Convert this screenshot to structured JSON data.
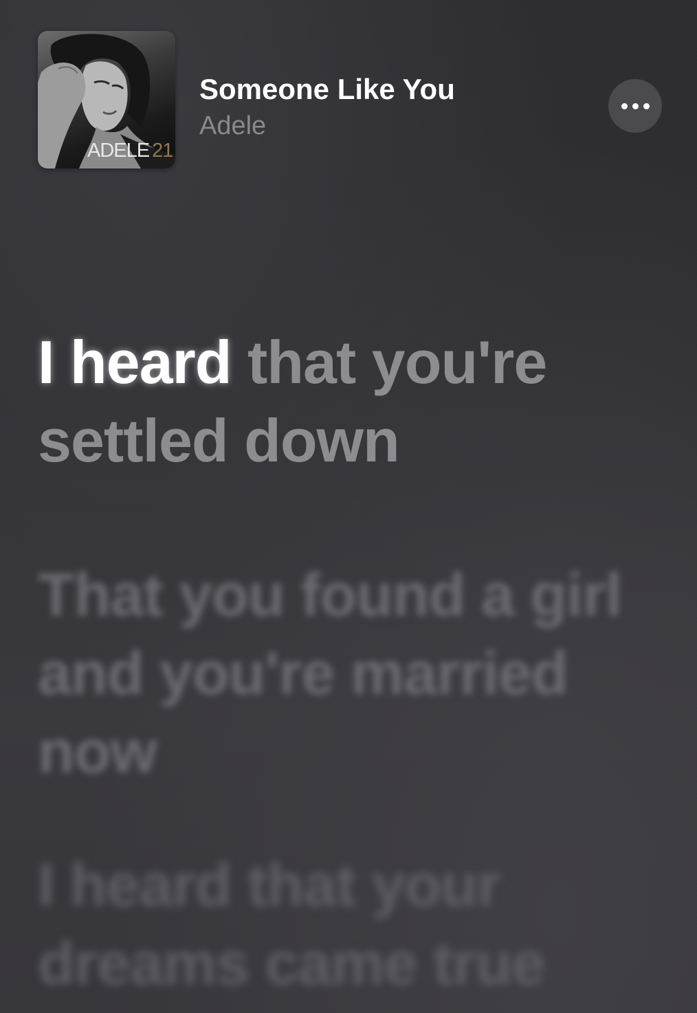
{
  "now_playing": {
    "title": "Someone Like You",
    "artist": "Adele",
    "album_art": {
      "label": "ADELE",
      "number": "21"
    }
  },
  "more_button": {
    "icon": "ellipsis-icon"
  },
  "lyrics": {
    "current_sung": "I heard",
    "current_unsung": " that you're settled down",
    "next_line": "That you found a girl and you're married now",
    "following_line": "I heard that your dreams came true"
  },
  "colors": {
    "background": "#2f2f33",
    "active_text": "#ffffff",
    "inactive_text": "#8d8c91",
    "more_button_bg": "#4a4a4f"
  }
}
